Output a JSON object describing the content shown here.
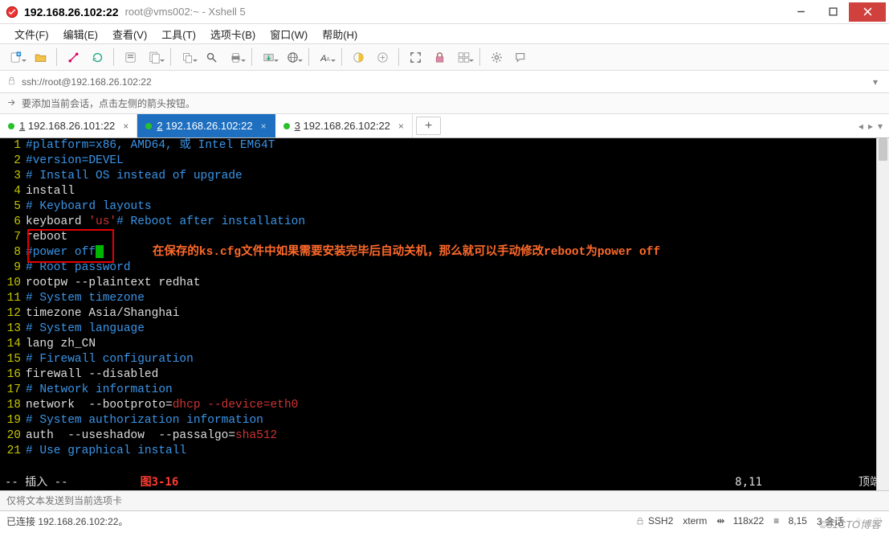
{
  "window": {
    "title": "192.168.26.102:22",
    "subtitle": "root@vms002:~ - Xshell 5"
  },
  "menu": {
    "items": [
      "文件(F)",
      "编辑(E)",
      "查看(V)",
      "工具(T)",
      "选项卡(B)",
      "窗口(W)",
      "帮助(H)"
    ]
  },
  "address": {
    "url": "ssh://root@192.168.26.102:22"
  },
  "hint": "要添加当前会话，点击左侧的箭头按钮。",
  "tabs": {
    "items": [
      {
        "num": "1",
        "label": "192.168.26.101:22"
      },
      {
        "num": "2",
        "label": "192.168.26.102:22"
      },
      {
        "num": "3",
        "label": "192.168.26.102:22"
      }
    ],
    "activeIndex": 1,
    "addLabel": "+"
  },
  "terminal": {
    "lines": [
      {
        "n": "1",
        "segs": [
          {
            "c": "c-cmt",
            "t": "#platform=x86, AMD64, 或 Intel EM64T"
          }
        ]
      },
      {
        "n": "2",
        "segs": [
          {
            "c": "c-cmt",
            "t": "#version=DEVEL"
          }
        ]
      },
      {
        "n": "3",
        "segs": [
          {
            "c": "c-cmt",
            "t": "# Install OS instead of upgrade"
          }
        ]
      },
      {
        "n": "4",
        "segs": [
          {
            "c": "c-w",
            "t": "install"
          }
        ]
      },
      {
        "n": "5",
        "segs": [
          {
            "c": "c-cmt",
            "t": "# Keyboard layouts"
          }
        ]
      },
      {
        "n": "6",
        "segs": [
          {
            "c": "c-w",
            "t": "keyboard "
          },
          {
            "c": "c-red",
            "t": "'us'"
          },
          {
            "c": "c-cmt",
            "t": "# Reboot after installation"
          }
        ]
      },
      {
        "n": "7",
        "segs": [
          {
            "c": "c-w",
            "t": "reboot"
          }
        ]
      },
      {
        "n": "8",
        "segs": [
          {
            "c": "c-cmt",
            "t": "#power off"
          }
        ],
        "cursor": true,
        "annotation": "在保存的ks.cfg文件中如果需要安装完毕后自动关机，那么就可以手动修改reboot为power off"
      },
      {
        "n": "9",
        "segs": [
          {
            "c": "c-cmt",
            "t": "# Root password"
          }
        ]
      },
      {
        "n": "10",
        "segs": [
          {
            "c": "c-w",
            "t": "rootpw --plaintext redhat"
          }
        ]
      },
      {
        "n": "11",
        "segs": [
          {
            "c": "c-cmt",
            "t": "# System timezone"
          }
        ]
      },
      {
        "n": "12",
        "segs": [
          {
            "c": "c-w",
            "t": "timezone Asia/Shanghai"
          }
        ]
      },
      {
        "n": "13",
        "segs": [
          {
            "c": "c-cmt",
            "t": "# System language"
          }
        ]
      },
      {
        "n": "14",
        "segs": [
          {
            "c": "c-w",
            "t": "lang zh_CN"
          }
        ]
      },
      {
        "n": "15",
        "segs": [
          {
            "c": "c-cmt",
            "t": "# Firewall configuration"
          }
        ]
      },
      {
        "n": "16",
        "segs": [
          {
            "c": "c-w",
            "t": "firewall --disabled"
          }
        ]
      },
      {
        "n": "17",
        "segs": [
          {
            "c": "c-cmt",
            "t": "# Network information"
          }
        ]
      },
      {
        "n": "18",
        "segs": [
          {
            "c": "c-w",
            "t": "network  --bootproto="
          },
          {
            "c": "c-red",
            "t": "dhcp --device=eth0"
          }
        ]
      },
      {
        "n": "19",
        "segs": [
          {
            "c": "c-cmt",
            "t": "# System authorization information"
          }
        ]
      },
      {
        "n": "20",
        "segs": [
          {
            "c": "c-w",
            "t": "auth  --useshadow  --passalgo="
          },
          {
            "c": "c-red",
            "t": "sha512"
          }
        ]
      },
      {
        "n": "21",
        "segs": [
          {
            "c": "c-cmt",
            "t": "# Use graphical install"
          }
        ]
      }
    ],
    "vim_mode": "-- 插入 --",
    "figure_label": "图3-16",
    "cursor_pos": "8,11",
    "edge_label": "顶端"
  },
  "input_placeholder": "仅将文本发送到当前选项卡",
  "statusbar": {
    "conn": "已连接 192.168.26.102:22。",
    "proto": "SSH2",
    "term": "xterm",
    "size": "118x22",
    "caret": "8,15",
    "sessions": "3 会话",
    "watermark": "©51CTO博客"
  }
}
